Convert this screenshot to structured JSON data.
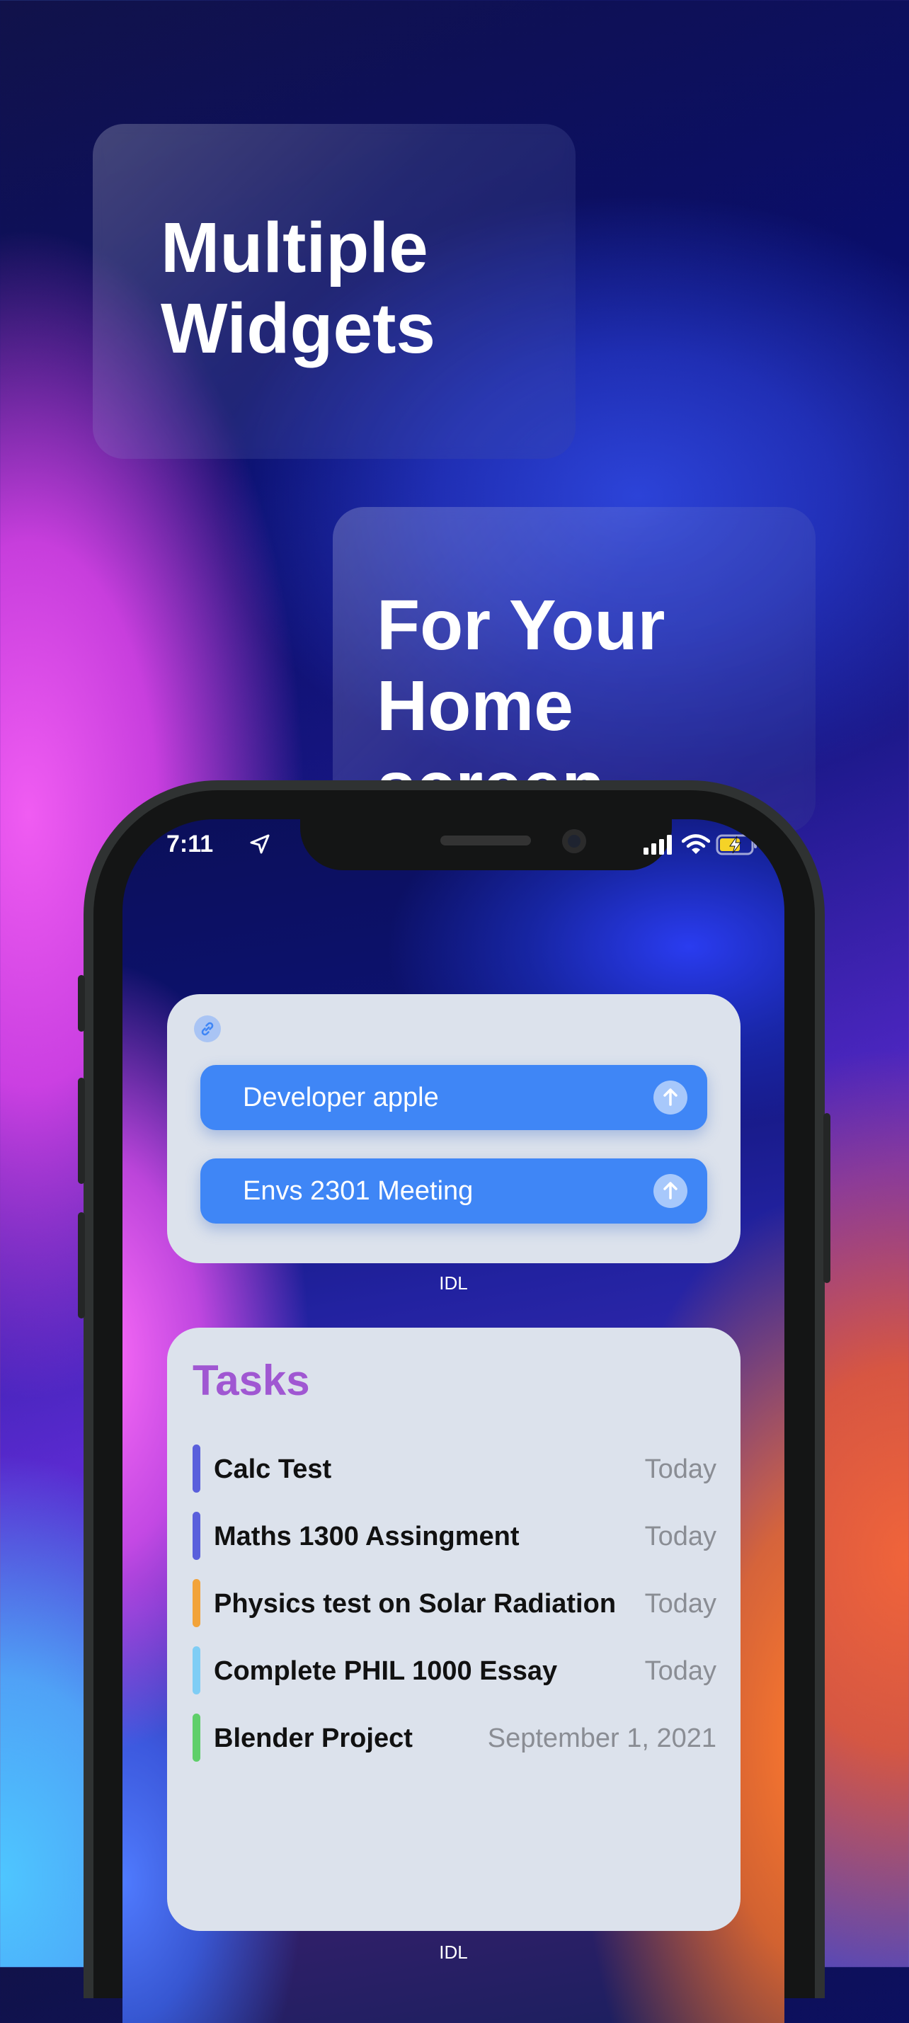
{
  "promo": {
    "card1_title_line1": "Multiple",
    "card1_title_line2": "Widgets",
    "card2_title_line1": "For Your",
    "card2_title_line2": "Home screen"
  },
  "status_bar": {
    "time": "7:11"
  },
  "links_widget": {
    "links": [
      {
        "label": "Developer apple"
      },
      {
        "label": "Envs 2301 Meeting"
      }
    ],
    "caption": "IDL"
  },
  "tasks_widget": {
    "title": "Tasks",
    "tasks": [
      {
        "name": "Calc Test",
        "date": "Today",
        "color": "#5a5fdc"
      },
      {
        "name": "Maths 1300 Assingment",
        "date": "Today",
        "color": "#5a5fdc"
      },
      {
        "name": "Physics test on Solar Radiation",
        "date": "Today",
        "color": "#f2a33a"
      },
      {
        "name": "Complete PHIL 1000 Essay",
        "date": "Today",
        "color": "#7fcdf5"
      },
      {
        "name": "Blender Project",
        "date": "September 1, 2021",
        "color": "#5fcf6a"
      }
    ],
    "caption": "IDL"
  },
  "colors": {
    "accent_blue": "#3f86f6",
    "tasks_title": "#a057d2"
  }
}
